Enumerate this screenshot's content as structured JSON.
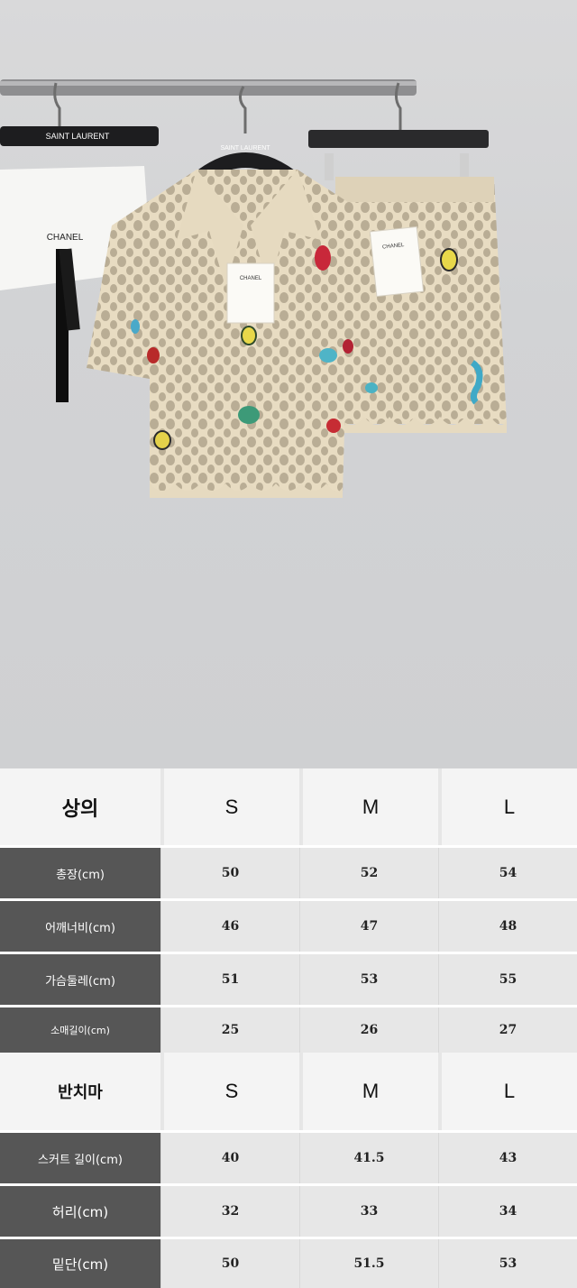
{
  "photo": {
    "tags": {
      "hanger_brand": "SAINT LAURENT",
      "hanger_sub": "PARIS",
      "bag_brand": "CHANEL",
      "hangtag_brand": "CHANEL"
    }
  },
  "top_table": {
    "title": "상의",
    "sizes": [
      "S",
      "M",
      "L"
    ],
    "rows": [
      {
        "label": "총장(cm)",
        "values": [
          "50",
          "52",
          "54"
        ]
      },
      {
        "label": "어깨너비(cm)",
        "values": [
          "46",
          "47",
          "48"
        ]
      },
      {
        "label": "가슴둘레(cm)",
        "values": [
          "51",
          "53",
          "55"
        ]
      },
      {
        "label": "소매길이(cm)",
        "values": [
          "25",
          "26",
          "27"
        ]
      }
    ]
  },
  "bottom_table": {
    "title": "반치마",
    "sizes": [
      "S",
      "M",
      "L"
    ],
    "rows": [
      {
        "label": "스커트 길이(cm)",
        "values": [
          "40",
          "41.5",
          "43"
        ]
      },
      {
        "label": "허리(cm)",
        "values": [
          "32",
          "33",
          "34"
        ]
      },
      {
        "label": "밑단(cm)",
        "values": [
          "50",
          "51.5",
          "53"
        ]
      }
    ]
  }
}
